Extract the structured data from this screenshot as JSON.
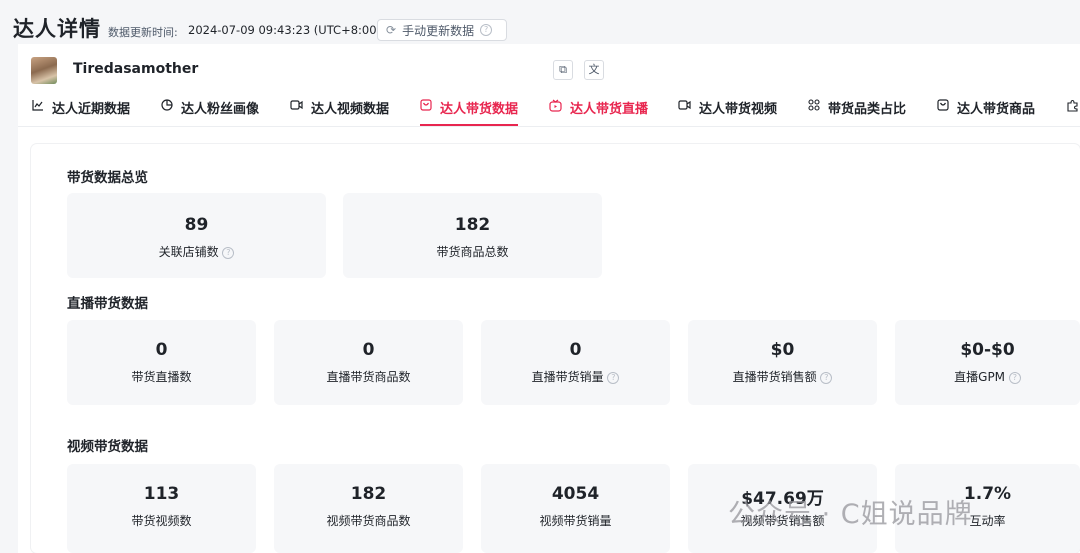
{
  "header": {
    "title": "达人详情",
    "update_label": "数据更新时间:",
    "update_time": "2024-07-09 09:43:23 (UTC+8:00)",
    "refresh_label": "手动更新数据"
  },
  "creator": {
    "name": "Tiredasamother"
  },
  "tabs": [
    {
      "label": "达人近期数据",
      "icon": "line-chart-icon"
    },
    {
      "label": "达人粉丝画像",
      "icon": "pie-chart-icon"
    },
    {
      "label": "达人视频数据",
      "icon": "video-icon"
    },
    {
      "label": "达人带货数据",
      "icon": "shopping-bag-icon",
      "active": true
    },
    {
      "label": "达人带货直播",
      "icon": "live-icon"
    },
    {
      "label": "达人带货视频",
      "icon": "video-icon"
    },
    {
      "label": "带货品类占比",
      "icon": "grid-icon"
    },
    {
      "label": "达人带货商品",
      "icon": "shopping-bag-icon"
    }
  ],
  "overview": {
    "title": "带货数据总览",
    "cards": [
      {
        "value": "89",
        "label": "关联店铺数",
        "help": true
      },
      {
        "value": "182",
        "label": "带货商品总数",
        "help": false
      }
    ]
  },
  "live": {
    "title": "直播带货数据",
    "cards": [
      {
        "value": "0",
        "label": "带货直播数",
        "help": false
      },
      {
        "value": "0",
        "label": "直播带货商品数",
        "help": false
      },
      {
        "value": "0",
        "label": "直播带货销量",
        "help": true
      },
      {
        "value": "$0",
        "label": "直播带货销售额",
        "help": true
      },
      {
        "value": "$0-$0",
        "label": "直播GPM",
        "help": true
      }
    ]
  },
  "video": {
    "title": "视频带货数据",
    "cards": [
      {
        "value": "113",
        "label": "带货视频数",
        "help": false
      },
      {
        "value": "182",
        "label": "视频带货商品数",
        "help": false
      },
      {
        "value": "4054",
        "label": "视频带货销量",
        "help": false
      },
      {
        "value": "$47.69万",
        "label": "视频带货销售额",
        "help": false
      },
      {
        "value": "1.7%",
        "label": "互动率",
        "help": false
      }
    ]
  },
  "watermark": "公众号 · C姐说品牌",
  "colors": {
    "accent": "#e8264f",
    "card_bg": "#f6f7f9",
    "page_bg": "#f5f6f8"
  }
}
